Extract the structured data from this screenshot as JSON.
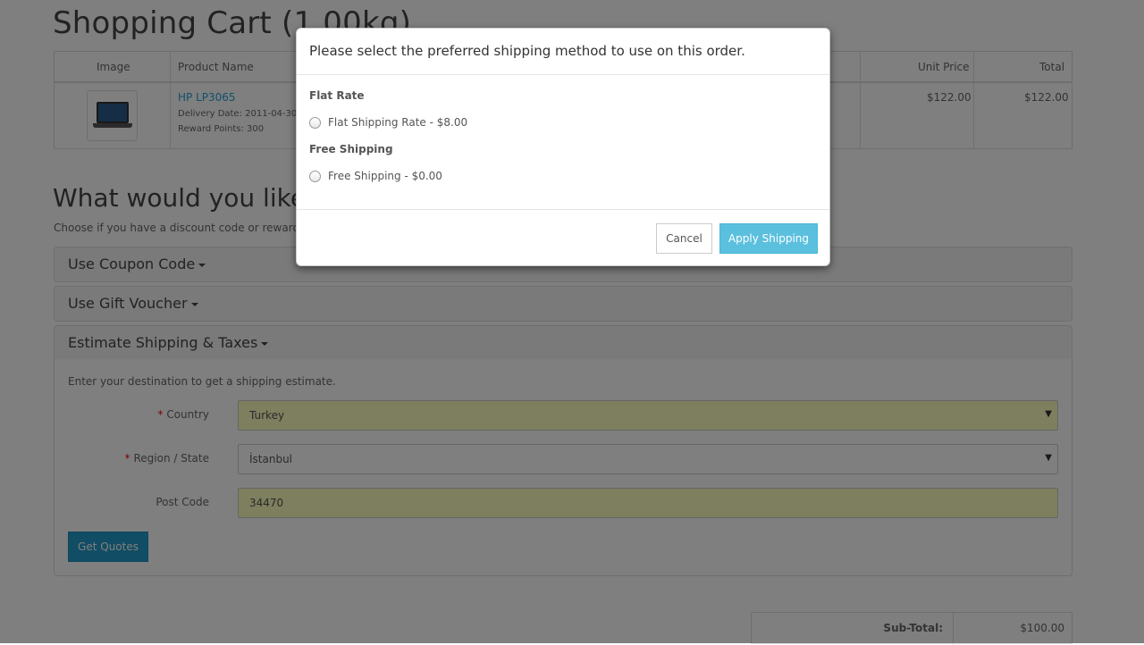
{
  "page": {
    "title": "Shopping Cart  (1.00kg)",
    "table": {
      "headers": [
        "Image",
        "Product Name",
        "Unit Price",
        "Total"
      ],
      "row": {
        "product_name": "HP LP3065",
        "delivery_date": "Delivery Date: 2011-04-30",
        "reward_points": "Reward Points: 300",
        "unit_price": "$122.00",
        "total": "$122.00"
      }
    },
    "next_heading": "What would you like t",
    "next_subtext": "Choose if you have a discount code or reward po",
    "panels": [
      "Use Coupon Code",
      "Use Gift Voucher",
      "Estimate Shipping & Taxes"
    ],
    "shipping_form": {
      "note": "Enter your destination to get a shipping estimate.",
      "country_label": "Country",
      "country_value": "Turkey",
      "region_label": "Region / State",
      "region_value": "İstanbul",
      "postcode_label": "Post Code",
      "postcode_value": "34470",
      "required_mark": "*",
      "get_quotes": "Get Quotes"
    },
    "totals": {
      "subtotal_label": "Sub-Total:",
      "subtotal_value": "$100.00"
    }
  },
  "modal": {
    "title": "Please select the preferred shipping method to use on this order.",
    "groups": [
      {
        "title": "Flat Rate",
        "option": "Flat Shipping Rate - $8.00"
      },
      {
        "title": "Free Shipping",
        "option": "Free Shipping - $0.00"
      }
    ],
    "cancel_label": "Cancel",
    "apply_label": "Apply Shipping"
  },
  "colors": {
    "link": "#23a1d1",
    "primary_button": "#229ac8",
    "info_button": "#5bc0de",
    "autofill": "#faffbd"
  }
}
